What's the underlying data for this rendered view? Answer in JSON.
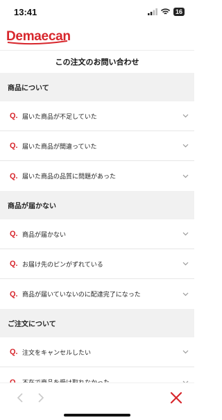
{
  "status": {
    "time": "13:41",
    "battery": "16"
  },
  "brand": {
    "name": "Demaecan",
    "color": "#d7262c"
  },
  "page": {
    "title": "この注文のお問い合わせ"
  },
  "q_label": "Q.",
  "sections": [
    {
      "title": "商品について",
      "items": [
        "届いた商品が不足していた",
        "届いた商品が間違っていた",
        "届いた商品の品質に問題があった"
      ]
    },
    {
      "title": "商品が届かない",
      "items": [
        "商品が届かない",
        "お届け先のピンがずれている",
        "商品が届いていないのに配達完了になった"
      ]
    },
    {
      "title": "ご注文について",
      "items": [
        "注文をキャンセルしたい",
        "不在で商品を受け取れなかった"
      ]
    }
  ],
  "icons": {
    "signal": "signal-icon",
    "wifi": "wifi-icon",
    "chevron": "chevron-down-icon",
    "back": "back-arrow-icon",
    "forward": "forward-arrow-icon",
    "close": "close-icon"
  }
}
